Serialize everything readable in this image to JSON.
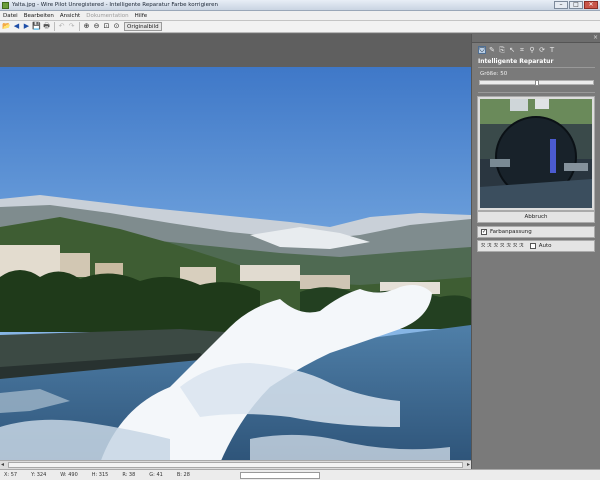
{
  "window": {
    "title": "Yalta.jpg - Wire Pilot Unregistered - Intelligente Reparatur Farbe korrigieren",
    "minimize": "–",
    "maximize": "□",
    "close": "✕"
  },
  "menu": {
    "items": [
      {
        "label": "Datei",
        "enabled": true
      },
      {
        "label": "Bearbeiten",
        "enabled": true
      },
      {
        "label": "Ansicht",
        "enabled": true
      },
      {
        "label": "Dokumentation",
        "enabled": false
      },
      {
        "label": "Hilfe",
        "enabled": true
      }
    ]
  },
  "toolbar": {
    "open": "📂",
    "back": "◀",
    "forward": "▶",
    "save": "💾",
    "print": "🖶",
    "undo": "↶",
    "redo": "↷",
    "zoom_in": "⊕",
    "zoom_out": "⊖",
    "zoom_fit": "⊡",
    "zoom_actual": "⊙",
    "original_label": "Originalbild"
  },
  "panel": {
    "close": "×",
    "title": "Intelligente Reparatur",
    "size_label": "Größe: 50",
    "size_value": 50,
    "size_max": 100,
    "cancel_label": "Abbruch",
    "color_match_label": "Farbanpassung",
    "color_match_checked": true,
    "auto_label": "Auto",
    "auto_checked": false,
    "brush_glyph": "ℛ"
  },
  "status": {
    "x": "X: 57",
    "y": "Y: 324",
    "w": "W: 490",
    "h": "H: 315",
    "r": "R: 38",
    "g": "G: 41",
    "b": "B: 28"
  },
  "colors": {
    "accent": "#4f6e92",
    "panel_bg": "#7a7a7a",
    "canvas_bg": "#5f5f5f"
  }
}
